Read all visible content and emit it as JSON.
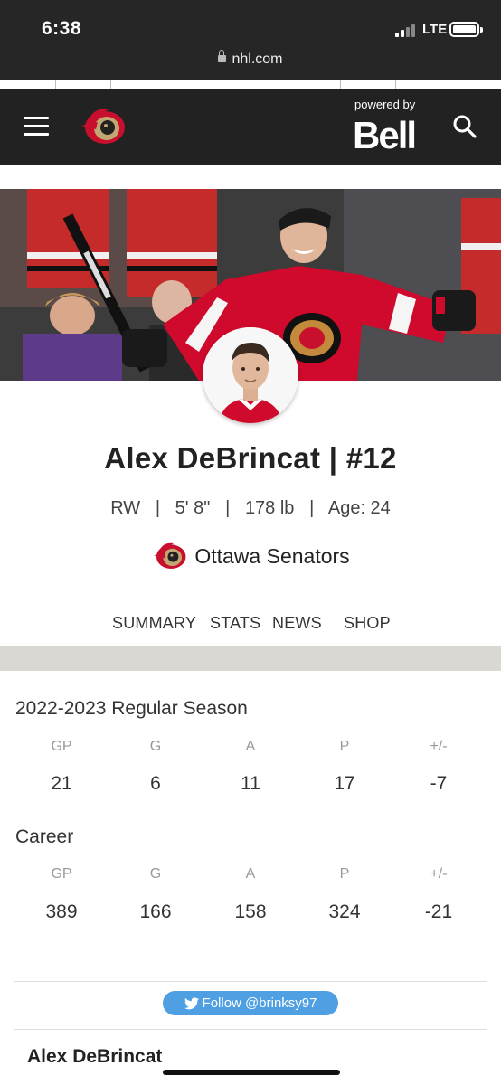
{
  "status_bar": {
    "time": "6:38",
    "network": "LTE",
    "url": "nhl.com"
  },
  "header": {
    "powered_by": "powered by",
    "sponsor": "Bell"
  },
  "player": {
    "name_line": "Alex DeBrincat | #12",
    "bio_line": "RW   |   5' 8\"   |   178 lb   |   Age: 24",
    "team": "Ottawa Senators"
  },
  "tabs": [
    "SUMMARY",
    "STATS",
    "NEWS",
    "SHOP"
  ],
  "stat_columns": [
    "GP",
    "G",
    "A",
    "P",
    "+/-"
  ],
  "season": {
    "title": "2022-2023 Regular Season",
    "values": [
      "21",
      "6",
      "11",
      "17",
      "-7"
    ]
  },
  "career": {
    "title": "Career",
    "values": [
      "389",
      "166",
      "158",
      "324",
      "-21"
    ]
  },
  "social": {
    "follow_label": "Follow @brinksy97"
  },
  "footer": {
    "name": "Alex DeBrincat"
  },
  "colors": {
    "senators_red": "#c8102e",
    "blackhawks_red": "#cf0a2c",
    "twitter_blue": "#4fa0e3",
    "header_dark": "#222222"
  }
}
